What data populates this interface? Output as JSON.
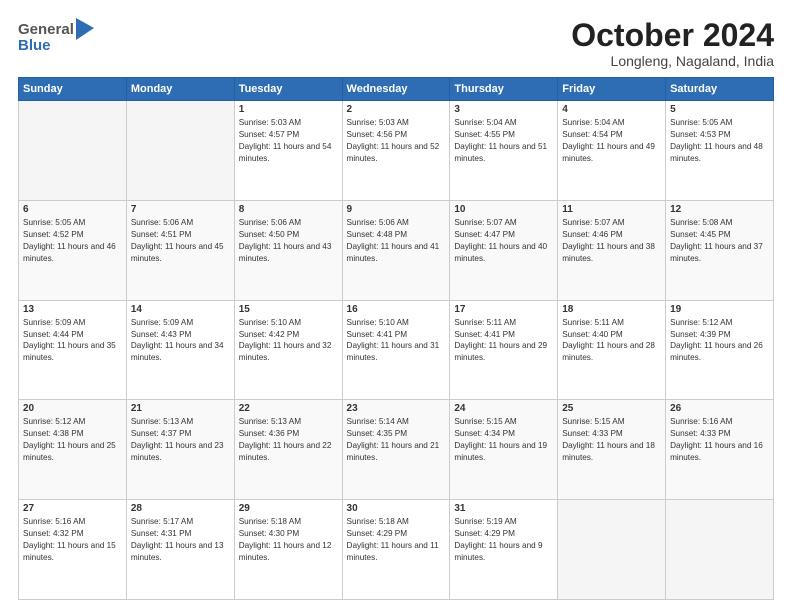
{
  "header": {
    "logo_line1": "General",
    "logo_line2": "Blue",
    "month": "October 2024",
    "location": "Longleng, Nagaland, India"
  },
  "weekdays": [
    "Sunday",
    "Monday",
    "Tuesday",
    "Wednesday",
    "Thursday",
    "Friday",
    "Saturday"
  ],
  "weeks": [
    [
      {
        "day": "",
        "info": ""
      },
      {
        "day": "",
        "info": ""
      },
      {
        "day": "1",
        "info": "Sunrise: 5:03 AM\nSunset: 4:57 PM\nDaylight: 11 hours and 54 minutes."
      },
      {
        "day": "2",
        "info": "Sunrise: 5:03 AM\nSunset: 4:56 PM\nDaylight: 11 hours and 52 minutes."
      },
      {
        "day": "3",
        "info": "Sunrise: 5:04 AM\nSunset: 4:55 PM\nDaylight: 11 hours and 51 minutes."
      },
      {
        "day": "4",
        "info": "Sunrise: 5:04 AM\nSunset: 4:54 PM\nDaylight: 11 hours and 49 minutes."
      },
      {
        "day": "5",
        "info": "Sunrise: 5:05 AM\nSunset: 4:53 PM\nDaylight: 11 hours and 48 minutes."
      }
    ],
    [
      {
        "day": "6",
        "info": "Sunrise: 5:05 AM\nSunset: 4:52 PM\nDaylight: 11 hours and 46 minutes."
      },
      {
        "day": "7",
        "info": "Sunrise: 5:06 AM\nSunset: 4:51 PM\nDaylight: 11 hours and 45 minutes."
      },
      {
        "day": "8",
        "info": "Sunrise: 5:06 AM\nSunset: 4:50 PM\nDaylight: 11 hours and 43 minutes."
      },
      {
        "day": "9",
        "info": "Sunrise: 5:06 AM\nSunset: 4:48 PM\nDaylight: 11 hours and 41 minutes."
      },
      {
        "day": "10",
        "info": "Sunrise: 5:07 AM\nSunset: 4:47 PM\nDaylight: 11 hours and 40 minutes."
      },
      {
        "day": "11",
        "info": "Sunrise: 5:07 AM\nSunset: 4:46 PM\nDaylight: 11 hours and 38 minutes."
      },
      {
        "day": "12",
        "info": "Sunrise: 5:08 AM\nSunset: 4:45 PM\nDaylight: 11 hours and 37 minutes."
      }
    ],
    [
      {
        "day": "13",
        "info": "Sunrise: 5:09 AM\nSunset: 4:44 PM\nDaylight: 11 hours and 35 minutes."
      },
      {
        "day": "14",
        "info": "Sunrise: 5:09 AM\nSunset: 4:43 PM\nDaylight: 11 hours and 34 minutes."
      },
      {
        "day": "15",
        "info": "Sunrise: 5:10 AM\nSunset: 4:42 PM\nDaylight: 11 hours and 32 minutes."
      },
      {
        "day": "16",
        "info": "Sunrise: 5:10 AM\nSunset: 4:41 PM\nDaylight: 11 hours and 31 minutes."
      },
      {
        "day": "17",
        "info": "Sunrise: 5:11 AM\nSunset: 4:41 PM\nDaylight: 11 hours and 29 minutes."
      },
      {
        "day": "18",
        "info": "Sunrise: 5:11 AM\nSunset: 4:40 PM\nDaylight: 11 hours and 28 minutes."
      },
      {
        "day": "19",
        "info": "Sunrise: 5:12 AM\nSunset: 4:39 PM\nDaylight: 11 hours and 26 minutes."
      }
    ],
    [
      {
        "day": "20",
        "info": "Sunrise: 5:12 AM\nSunset: 4:38 PM\nDaylight: 11 hours and 25 minutes."
      },
      {
        "day": "21",
        "info": "Sunrise: 5:13 AM\nSunset: 4:37 PM\nDaylight: 11 hours and 23 minutes."
      },
      {
        "day": "22",
        "info": "Sunrise: 5:13 AM\nSunset: 4:36 PM\nDaylight: 11 hours and 22 minutes."
      },
      {
        "day": "23",
        "info": "Sunrise: 5:14 AM\nSunset: 4:35 PM\nDaylight: 11 hours and 21 minutes."
      },
      {
        "day": "24",
        "info": "Sunrise: 5:15 AM\nSunset: 4:34 PM\nDaylight: 11 hours and 19 minutes."
      },
      {
        "day": "25",
        "info": "Sunrise: 5:15 AM\nSunset: 4:33 PM\nDaylight: 11 hours and 18 minutes."
      },
      {
        "day": "26",
        "info": "Sunrise: 5:16 AM\nSunset: 4:33 PM\nDaylight: 11 hours and 16 minutes."
      }
    ],
    [
      {
        "day": "27",
        "info": "Sunrise: 5:16 AM\nSunset: 4:32 PM\nDaylight: 11 hours and 15 minutes."
      },
      {
        "day": "28",
        "info": "Sunrise: 5:17 AM\nSunset: 4:31 PM\nDaylight: 11 hours and 13 minutes."
      },
      {
        "day": "29",
        "info": "Sunrise: 5:18 AM\nSunset: 4:30 PM\nDaylight: 11 hours and 12 minutes."
      },
      {
        "day": "30",
        "info": "Sunrise: 5:18 AM\nSunset: 4:29 PM\nDaylight: 11 hours and 11 minutes."
      },
      {
        "day": "31",
        "info": "Sunrise: 5:19 AM\nSunset: 4:29 PM\nDaylight: 11 hours and 9 minutes."
      },
      {
        "day": "",
        "info": ""
      },
      {
        "day": "",
        "info": ""
      }
    ]
  ]
}
